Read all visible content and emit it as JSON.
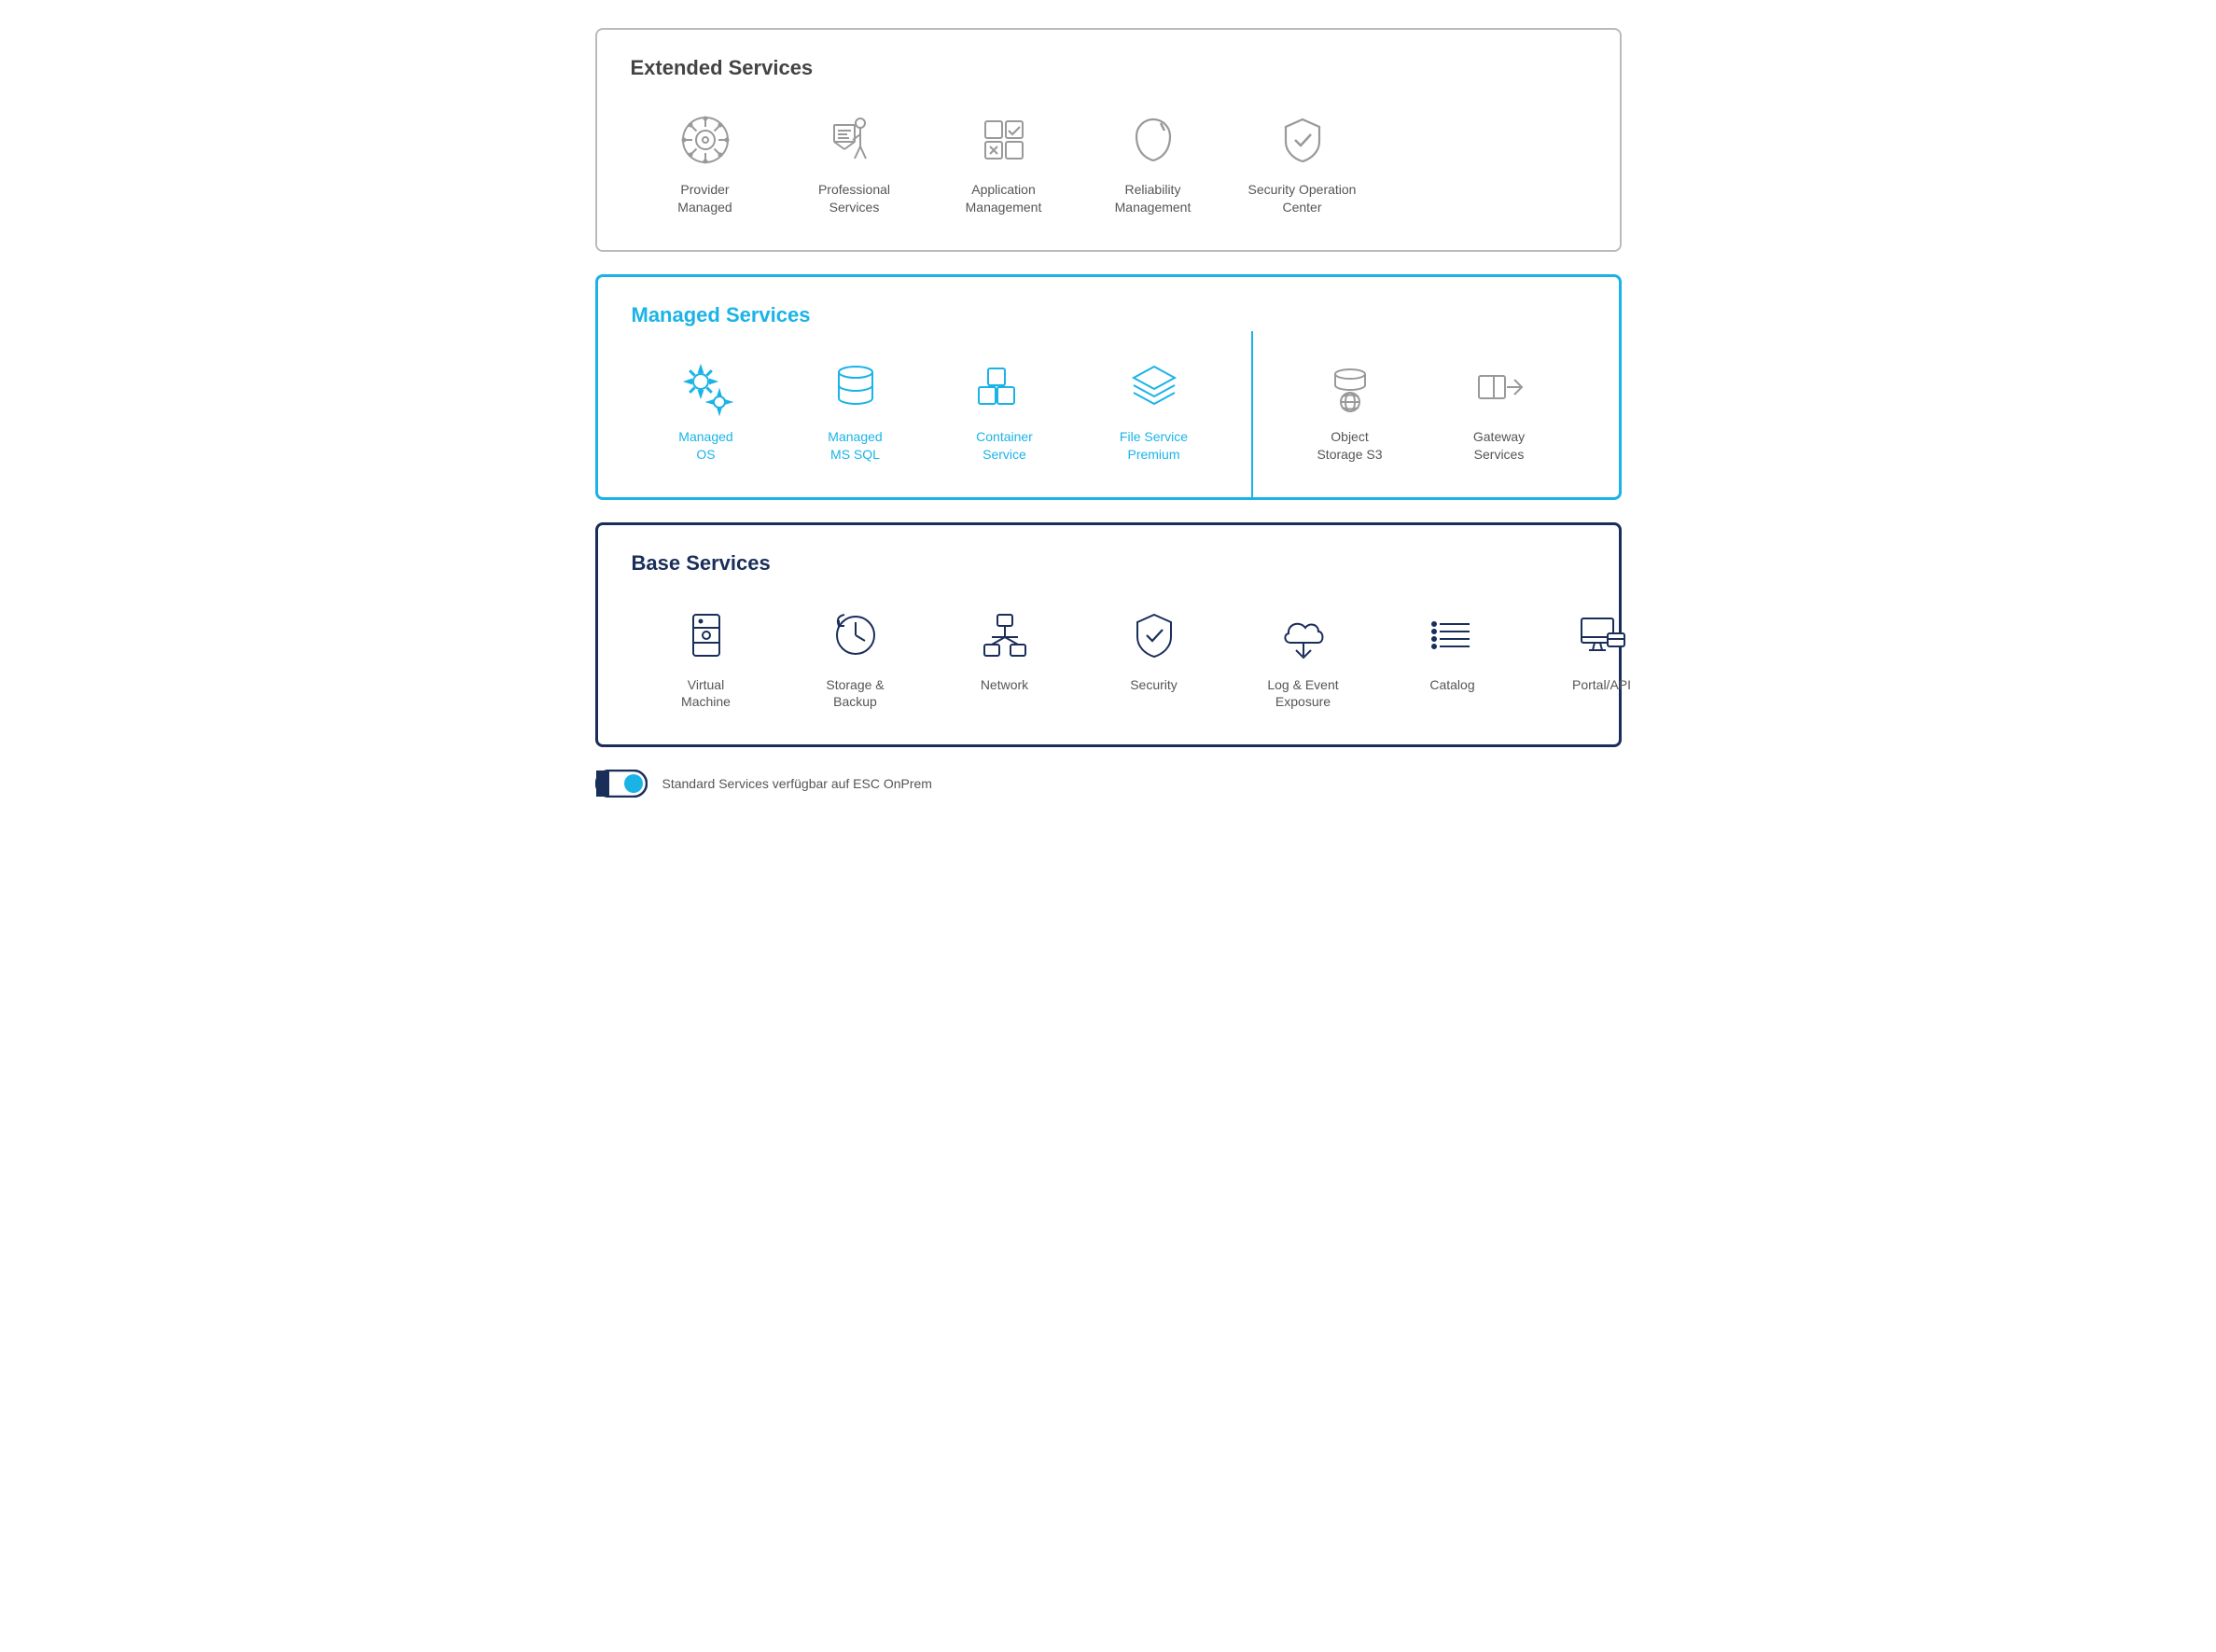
{
  "sections": {
    "extended": {
      "title": "Extended Services",
      "items": [
        {
          "id": "provider-managed",
          "label": "Provider\nManaged",
          "icon": "helm"
        },
        {
          "id": "professional-services",
          "label": "Professional\nServices",
          "icon": "presenter"
        },
        {
          "id": "application-management",
          "label": "Application\nManagement",
          "icon": "app-mgmt"
        },
        {
          "id": "reliability-management",
          "label": "Reliability\nManagement",
          "icon": "carabiner"
        },
        {
          "id": "security-operation-center",
          "label": "Security Operation\nCenter",
          "icon": "shield-check"
        }
      ]
    },
    "managed": {
      "title": "Managed Services",
      "items_left": [
        {
          "id": "managed-os",
          "label": "Managed\nOS",
          "icon": "gear-settings",
          "blue": true
        },
        {
          "id": "managed-ms-sql",
          "label": "Managed\nMS SQL",
          "icon": "database",
          "blue": true
        },
        {
          "id": "container-service",
          "label": "Container\nService",
          "icon": "containers",
          "blue": true
        },
        {
          "id": "file-service-premium",
          "label": "File Service\nPremium",
          "icon": "layers",
          "blue": true
        }
      ],
      "items_right": [
        {
          "id": "object-storage-s3",
          "label": "Object\nStorage S3",
          "icon": "db-globe",
          "blue": false
        },
        {
          "id": "gateway-services",
          "label": "Gateway\nServices",
          "icon": "gateway",
          "blue": false
        }
      ]
    },
    "base": {
      "title": "Base Services",
      "items": [
        {
          "id": "virtual-machine",
          "label": "Virtual\nMachine",
          "icon": "server"
        },
        {
          "id": "storage-backup",
          "label": "Storage &\nBackup",
          "icon": "clock-arrow"
        },
        {
          "id": "network",
          "label": "Network",
          "icon": "network-tree"
        },
        {
          "id": "security",
          "label": "Security",
          "icon": "shield"
        },
        {
          "id": "log-event-exposure",
          "label": "Log & Event\nExposure",
          "icon": "cloud-down"
        },
        {
          "id": "catalog",
          "label": "Catalog",
          "icon": "list-lines"
        },
        {
          "id": "portal-api",
          "label": "Portal/API",
          "icon": "portal"
        }
      ]
    }
  },
  "legend": {
    "text": "Standard Services verfügbar auf ESC OnPrem"
  }
}
